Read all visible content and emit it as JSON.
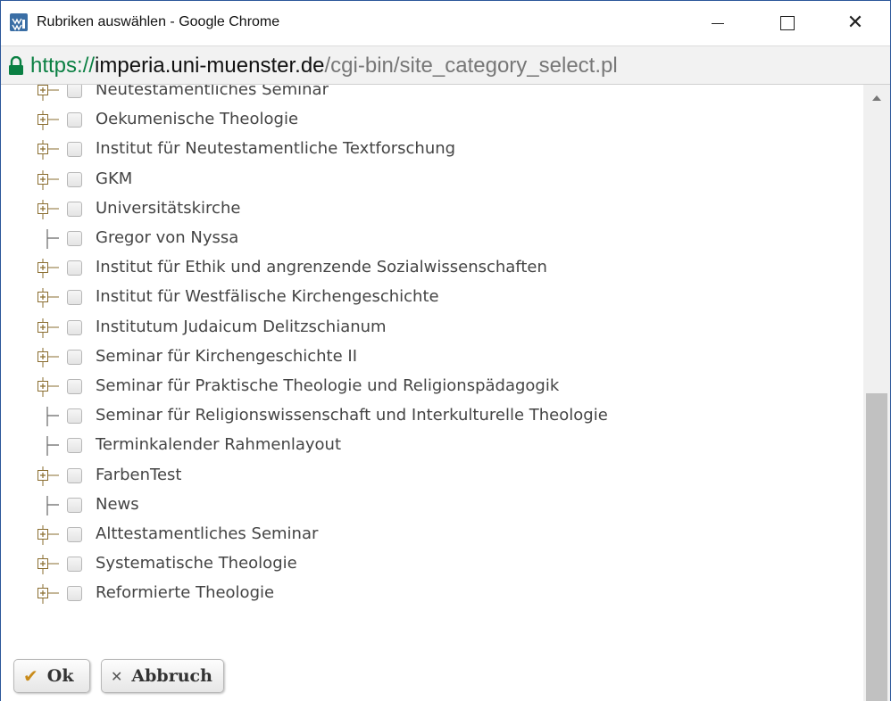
{
  "window": {
    "title": "Rubriken auswählen - Google Chrome",
    "icons": {
      "app": "university-logo-icon",
      "minimize": "minimize-icon",
      "maximize": "maximize-icon",
      "close": "close-icon"
    },
    "close_glyph": "✕"
  },
  "address_bar": {
    "lock_icon": "lock-icon",
    "scheme": "https://",
    "host": "imperia.uni-muenster.de",
    "path": "/cgi-bin/site_category_select.pl",
    "colors": {
      "secure": "#0b8043",
      "path": "#777777"
    }
  },
  "tree": {
    "items": [
      {
        "label": "Neutestamentliches Seminar",
        "node": "expand",
        "checked": false
      },
      {
        "label": "Oekumenische Theologie",
        "node": "expand",
        "checked": false
      },
      {
        "label": "Institut für Neutestamentliche Textforschung",
        "node": "expand",
        "checked": false
      },
      {
        "label": "GKM",
        "node": "expand",
        "checked": false
      },
      {
        "label": "Universitätskirche",
        "node": "expand",
        "checked": false
      },
      {
        "label": "Gregor von Nyssa",
        "node": "leaf",
        "checked": false
      },
      {
        "label": "Institut für Ethik und angrenzende Sozialwissenschaften",
        "node": "expand",
        "checked": false
      },
      {
        "label": "Institut für Westfälische Kirchengeschichte",
        "node": "expand",
        "checked": false
      },
      {
        "label": "Institutum Judaicum Delitzschianum",
        "node": "expand",
        "checked": false
      },
      {
        "label": "Seminar für Kirchengeschichte II",
        "node": "expand",
        "checked": false
      },
      {
        "label": "Seminar für Praktische Theologie und Religionspädagogik",
        "node": "expand",
        "checked": false
      },
      {
        "label": "Seminar für Religionswissenschaft und Interkulturelle Theologie",
        "node": "leaf",
        "checked": false
      },
      {
        "label": "Terminkalender Rahmenlayout",
        "node": "leaf",
        "checked": false
      },
      {
        "label": "FarbenTest",
        "node": "expand",
        "checked": false
      },
      {
        "label": "News",
        "node": "leaf",
        "checked": false
      },
      {
        "label": "Alttestamentliches Seminar",
        "node": "expand",
        "checked": false
      },
      {
        "label": "Systematische Theologie",
        "node": "expand",
        "checked": false
      },
      {
        "label": "Reformierte Theologie",
        "node": "expand",
        "checked": false
      }
    ]
  },
  "scrollbar": {
    "scroll_position": 1.0
  },
  "buttons": {
    "ok": {
      "label": "Ok",
      "icon": "checkmark-icon",
      "glyph": "✔"
    },
    "cancel": {
      "label": "Abbruch",
      "icon": "cross-icon",
      "glyph": "✕"
    }
  },
  "colors": {
    "accent_check": "#c98b1b",
    "label_text": "#444444",
    "window_border": "#2b579a"
  }
}
